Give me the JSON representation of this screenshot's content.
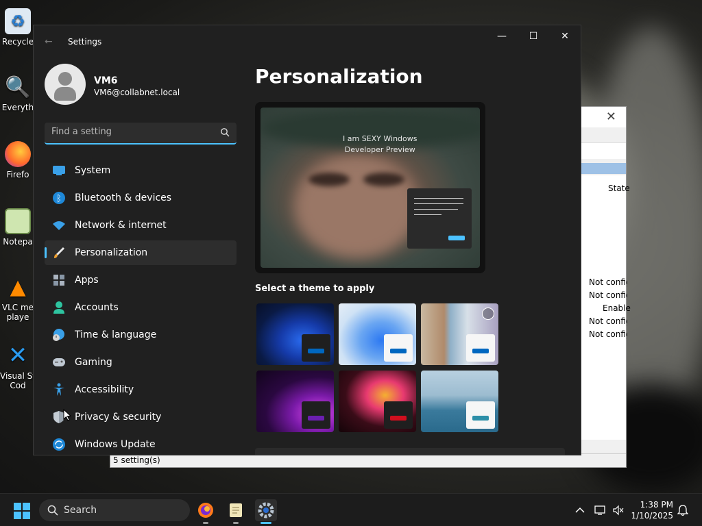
{
  "desktop": {
    "icons": [
      {
        "label": "Recycle",
        "icon": "recycle-bin-icon"
      },
      {
        "label": "Everyth",
        "icon": "everything-search-icon"
      },
      {
        "label": "Firefo",
        "icon": "firefox-icon"
      },
      {
        "label": "Notepa",
        "icon": "notepad-icon"
      },
      {
        "label": "VLC me",
        "label2": "playe",
        "icon": "vlc-icon"
      },
      {
        "label": "Visual St",
        "label2": "Cod",
        "icon": "vscode-icon"
      }
    ]
  },
  "background_window": {
    "column_header": "State",
    "states": [
      "Not config",
      "Not config",
      "Enable",
      "Not config",
      "Not config"
    ],
    "status": "5 setting(s)"
  },
  "settings": {
    "title": "Settings",
    "controls": {
      "minimize": "—",
      "maximize": "☐",
      "close": "✕"
    },
    "user": {
      "name": "VM6",
      "email": "VM6@collabnet.local"
    },
    "search": {
      "placeholder": "Find a setting",
      "value": ""
    },
    "nav": [
      {
        "label": "System",
        "icon": "system-icon",
        "active": false
      },
      {
        "label": "Bluetooth & devices",
        "icon": "bluetooth-icon",
        "active": false
      },
      {
        "label": "Network & internet",
        "icon": "wifi-icon",
        "active": false
      },
      {
        "label": "Personalization",
        "icon": "brush-icon",
        "active": true
      },
      {
        "label": "Apps",
        "icon": "apps-icon",
        "active": false
      },
      {
        "label": "Accounts",
        "icon": "accounts-icon",
        "active": false
      },
      {
        "label": "Time & language",
        "icon": "globe-clock-icon",
        "active": false
      },
      {
        "label": "Gaming",
        "icon": "gamepad-icon",
        "active": false
      },
      {
        "label": "Accessibility",
        "icon": "accessibility-icon",
        "active": false
      },
      {
        "label": "Privacy & security",
        "icon": "shield-icon",
        "active": false
      },
      {
        "label": "Windows Update",
        "icon": "update-icon",
        "active": false
      }
    ],
    "page_title": "Personalization",
    "preview": {
      "watermark_line1": "I am SEXY Windows",
      "watermark_line2": "Developer Preview"
    },
    "themes_label": "Select a theme to apply",
    "themes": [
      {
        "name": "windows-dark-bloom",
        "accent": "#0067c0"
      },
      {
        "name": "windows-light-bloom",
        "accent": "#0067c0"
      },
      {
        "name": "windows-spotlight",
        "accent": "#0067c0"
      },
      {
        "name": "glow",
        "accent": "#6b1fb1"
      },
      {
        "name": "captured-motion",
        "accent": "#d10f1e"
      },
      {
        "name": "flow",
        "accent": "#2d8fa8"
      }
    ]
  },
  "taskbar": {
    "search_label": "Search",
    "apps": [
      "firefox-icon",
      "notepad-icon",
      "settings-icon"
    ],
    "time": "1:38 PM",
    "date": "1/10/2025"
  },
  "colors": {
    "accent": "#4cc2ff",
    "window_bg": "#202020",
    "taskbar_bg": "#1c1c1c"
  }
}
